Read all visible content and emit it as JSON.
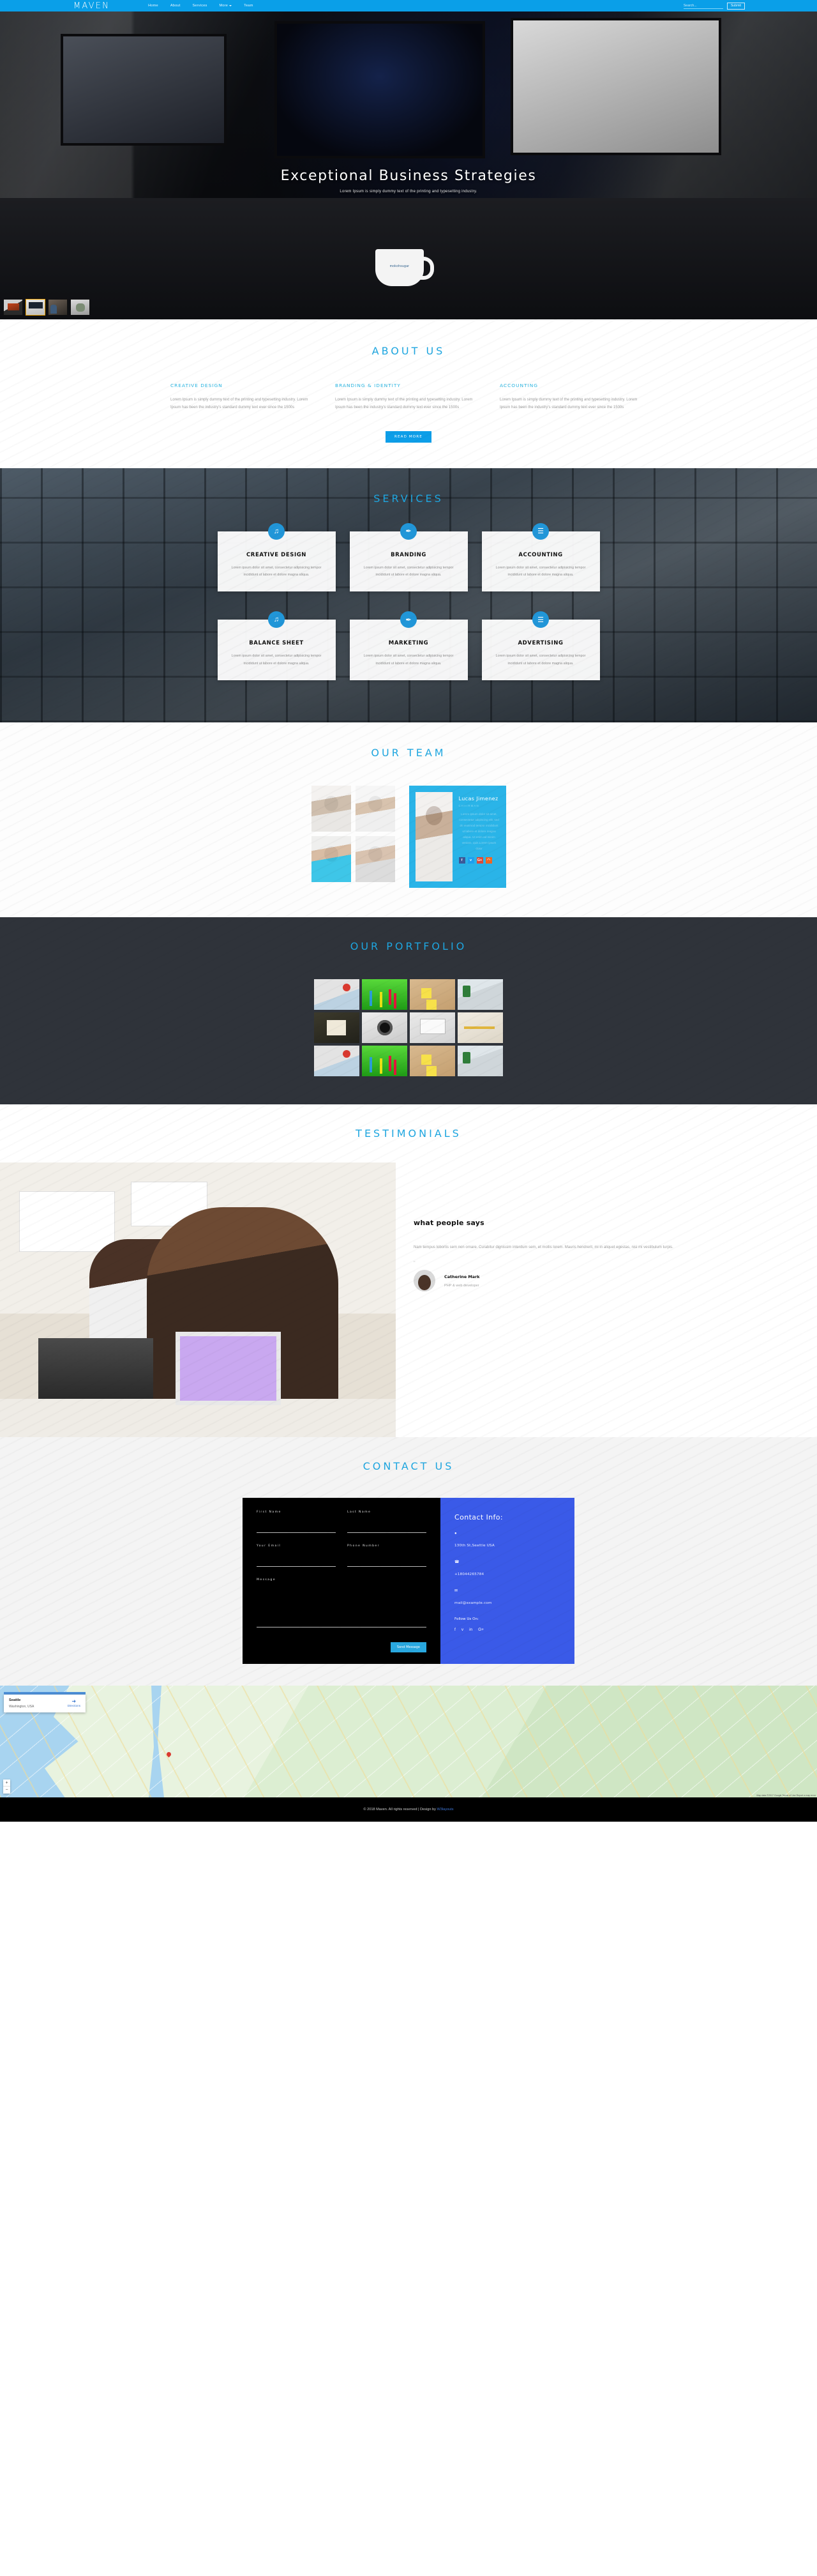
{
  "site": {
    "logo": "MAVEN"
  },
  "nav": {
    "items": [
      {
        "label": "Home"
      },
      {
        "label": "About"
      },
      {
        "label": "Services"
      },
      {
        "label": "More",
        "has_caret": true
      },
      {
        "label": "Team"
      }
    ],
    "search_placeholder": "Search...",
    "search_value": "",
    "submit_label": "Submit"
  },
  "hero": {
    "title": "Exceptional Business Strategies",
    "subtitle": "Lorem Ipsum is simply dummy text of the printing and typesetting industry.",
    "cup_label": "mokohsugar",
    "slides": [
      {
        "name": "slide-1",
        "active": false
      },
      {
        "name": "slide-2",
        "active": true
      },
      {
        "name": "slide-3",
        "active": false
      },
      {
        "name": "slide-4",
        "active": false
      }
    ]
  },
  "about": {
    "title": "ABOUT US",
    "columns": [
      {
        "heading": "CREATIVE DESIGN",
        "body": "Lorem Ipsum is simply dummy text of the printing and typesetting industry. Lorem Ipsum has been the industry's standard dummy text ever since the 1500s"
      },
      {
        "heading": "BRANDING & IDENTITY",
        "body": "Lorem Ipsum is simply dummy text of the printing and typesetting industry. Lorem Ipsum has been the industry's standard dummy text ever since the 1500s"
      },
      {
        "heading": "ACCOUNTING",
        "body": "Lorem Ipsum is simply dummy text of the printing and typesetting industry. Lorem Ipsum has been the industry's standard dummy text ever since the 1500s"
      }
    ],
    "read_more_label": "READ MORE"
  },
  "services": {
    "title": "SERVICES",
    "body_text": "Lorem ipsum dolor sit amet, consectetur adipisicing tempor incididunt ut labore et dolore magna aliqua.",
    "cards": [
      {
        "icon": "music-note-icon",
        "glyph": "♫",
        "heading": "CREATIVE DESIGN"
      },
      {
        "icon": "magic-wand-icon",
        "glyph": "✒",
        "heading": "BRANDING"
      },
      {
        "icon": "book-icon",
        "glyph": "☰",
        "heading": "ACCOUNTING"
      },
      {
        "icon": "music-note-icon",
        "glyph": "♫",
        "heading": "BALANCE SHEET"
      },
      {
        "icon": "magic-wand-icon",
        "glyph": "✒",
        "heading": "MARKETING"
      },
      {
        "icon": "book-icon",
        "glyph": "☰",
        "heading": "ADVERTISING"
      }
    ]
  },
  "team": {
    "title": "OUR TEAM",
    "thumbs": [
      {
        "name": "team-thumb-1"
      },
      {
        "name": "team-thumb-2"
      },
      {
        "name": "team-thumb-3"
      },
      {
        "name": "team-thumb-4"
      }
    ],
    "featured": {
      "name": "Lucas Jimenez",
      "role": "CHAIRMAN",
      "bio": "Lorem ipsum dolor sit amet, consectetur adipiscing elit, sed do eiusmod tempor incididunt ut labore et dolore magna aliqua. Ut enim ad minim veniam, quis.Lorem ipsum dolor",
      "social": [
        {
          "name": "facebook-icon",
          "glyph": "f"
        },
        {
          "name": "twitter-icon",
          "glyph": "ᴠ"
        },
        {
          "name": "google-plus-icon",
          "glyph": "G+"
        },
        {
          "name": "rss-icon",
          "glyph": "◠"
        }
      ]
    }
  },
  "portfolio": {
    "title": "OUR PORTFOLIO",
    "items": [
      {
        "name": "portfolio-item-1",
        "style": "pfA"
      },
      {
        "name": "portfolio-item-2",
        "style": "pfB"
      },
      {
        "name": "portfolio-item-3",
        "style": "pfC"
      },
      {
        "name": "portfolio-item-4",
        "style": "pfD"
      },
      {
        "name": "portfolio-item-5",
        "style": "pfE"
      },
      {
        "name": "portfolio-item-6",
        "style": "pfF"
      },
      {
        "name": "portfolio-item-7",
        "style": "pfG"
      },
      {
        "name": "portfolio-item-8",
        "style": "pfH"
      },
      {
        "name": "portfolio-item-9",
        "style": "pfA"
      },
      {
        "name": "portfolio-item-10",
        "style": "pfB"
      },
      {
        "name": "portfolio-item-11",
        "style": "pfC"
      },
      {
        "name": "portfolio-item-12",
        "style": "pfD"
      }
    ]
  },
  "testimonials": {
    "title": "TESTIMONIALS",
    "heading": "what people says",
    "quote": "Nam tempus lobortis sem non ornare. Curabitur dignissim interdum sem, et mollis lorem. Mauris hendrerit, mi in aliquet egestas, nisi mi vestibulum turpis.",
    "quote_mark": "“",
    "author_name": "Catherine Mark",
    "author_role": "PHP & web developer"
  },
  "contact": {
    "title": "CONTACT US",
    "form": {
      "first_name_label": "First Name",
      "first_name_value": "",
      "last_name_label": "Last Name",
      "last_name_value": "",
      "email_label": "Your Email",
      "email_value": "",
      "phone_label": "Phone Number",
      "phone_value": "",
      "message_label": "Message",
      "message_value": "",
      "submit_label": "Send Message"
    },
    "info": {
      "heading": "Contact Info:",
      "address_icon": "location-pin-icon",
      "address": "130th St,Seattle USA",
      "phone_icon": "phone-icon",
      "phone": "+18044265784",
      "email_icon": "envelope-icon",
      "email": "mail@example.com",
      "follow_label": "Follow Us On:",
      "social": [
        {
          "name": "facebook-icon",
          "glyph": "f"
        },
        {
          "name": "twitter-icon",
          "glyph": "ᴠ"
        },
        {
          "name": "linkedin-icon",
          "glyph": "in"
        },
        {
          "name": "google-plus-icon",
          "glyph": "G+"
        }
      ]
    }
  },
  "map": {
    "card_title": "Seattle",
    "card_subtitle": "Washington, USA",
    "directions_label": "Directions",
    "directions_icon": "directions-arrow-icon",
    "zoom_in": "+",
    "zoom_out": "−",
    "attribution": "Map data ©2017 Google   Terms of Use   Report a map error"
  },
  "footer": {
    "text": "© 2018 Maven. All rights reserved | Design by ",
    "link_label": "W3layouts"
  },
  "colors": {
    "brand_blue": "#0a9fe8",
    "accent_cyan": "#2bb4e0",
    "team_card": "#2ab4e8",
    "contact_panel": "#3a5ae8",
    "dark_bg": "#2f333a",
    "slide_active": "#f0a500"
  }
}
